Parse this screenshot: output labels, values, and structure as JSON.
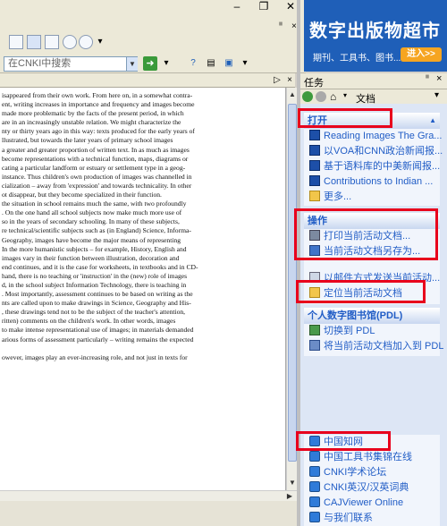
{
  "toolbar": {
    "search_placeholder": "在CNKI中搜索"
  },
  "ad": {
    "title": "数字出版物超市",
    "subtitle": "期刊、工具书、图书...",
    "enter_label": "进入>>"
  },
  "pane": {
    "title": "任务",
    "nav_label": "文档",
    "sections": [
      {
        "header": "打开",
        "items": [
          {
            "label": "Reading Images The Gra...",
            "icon": "pdf-icon"
          },
          {
            "label": "以VOA和CNN政治新闻报...",
            "icon": "pdf-icon"
          },
          {
            "label": "基于语料库的中美新闻报...",
            "icon": "pdf-icon"
          },
          {
            "label": "Contributions to Indian ...",
            "icon": "pdf-icon"
          },
          {
            "label": "更多...",
            "icon": "folder-icon"
          }
        ]
      },
      {
        "header": "操作",
        "items": [
          {
            "label": "打印当前活动文档...",
            "icon": "printer-icon"
          },
          {
            "label": "当前活动文档另存为...",
            "icon": "save-icon"
          },
          {
            "label": "以邮件方式发送当前活动...",
            "icon": "mail-icon"
          },
          {
            "label": "定位当前活动文档",
            "icon": "folder-icon"
          }
        ]
      },
      {
        "header": "个人数字图书馆(PDL)",
        "items": [
          {
            "label": "切换到 PDL",
            "icon": "switch-icon"
          },
          {
            "label": "将当前活动文档加入到 PDL",
            "icon": "add-icon"
          }
        ]
      },
      {
        "header": "",
        "items": [
          {
            "label": "中国知网",
            "icon": "web-icon"
          },
          {
            "label": "中国工具书集锦在线",
            "icon": "web-icon"
          },
          {
            "label": "CNKI学术论坛",
            "icon": "web-icon"
          },
          {
            "label": "CNKI英汉/汉英词典",
            "icon": "web-icon"
          },
          {
            "label": "CAJViewer Online",
            "icon": "web-icon"
          },
          {
            "label": "与我们联系",
            "icon": "web-icon"
          }
        ]
      }
    ]
  },
  "document": {
    "lines": [
      "isappeared from their own work. From here on, in a somewhat contra-",
      "ent, writing increases in importance and frequency and images become",
      " made more problematic by the facts of the present period, in which",
      "are in an increasingly unstable relation. We might characterize the",
      "nty or thirty years ago in this way: texts produced for the early years of",
      "llustrated, but towards the later years of primary school images",
      " a greater and greater proportion of written text. In as much as images",
      " become representations with a technical function, maps, diagrams or",
      "cating a particular landform or estuary or settlement type in a geog-",
      " instance. Thus children's own production of images was channelled in",
      "cialization – away from 'expression' and towards technicality. In other",
      "ot disappear, but they become specialized in their function.",
      " the situation in school remains much the same, with two profoundly",
      ". On the one hand all school subjects now make much more use of",
      " so in the years of secondary schooling. In many of these subjects,",
      "re technical/scientific subjects such as (in England) Science, Informa-",
      " Geography, images have become the major means of representing",
      " In the more humanistic subjects – for example, History, English and",
      " images vary in their function between illustration, decoration and",
      "end continues, and it is the case for worksheets, in textbooks and in CD-",
      " hand, there is no teaching or 'instruction' in the (new) role of images",
      "d, in the school subject Information Technology, there is teaching in",
      ". Most importantly, assessment continues to be based on writing as the",
      "nts are called upon to make drawings in Science, Geography and His-",
      ", these drawings tend not to be the subject of the teacher's attention,",
      "ritten) comments on the children's work. In other words, images",
      " to make intense representational use of images; in materials demanded",
      "arious forms of assessment particularly – writing remains the expected",
      "",
      "owever, images play an ever-increasing role, and not just in texts for"
    ]
  }
}
